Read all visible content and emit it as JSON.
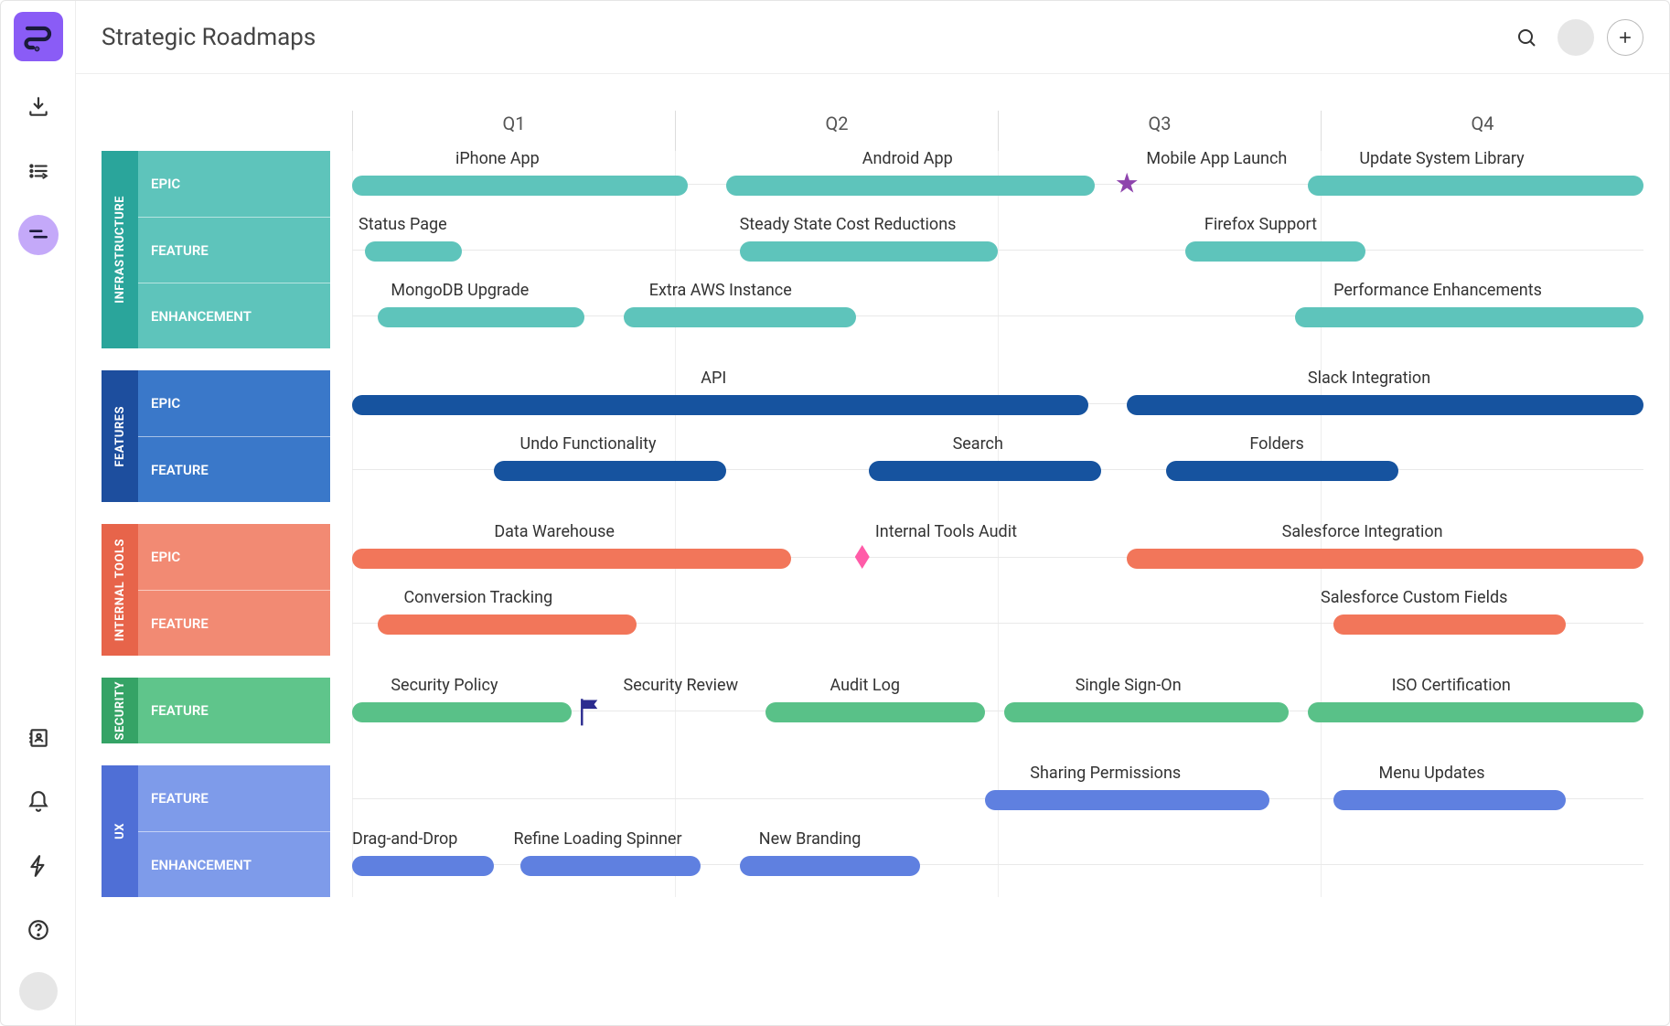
{
  "header": {
    "title": "Strategic Roadmaps"
  },
  "timeline": {
    "quarters": [
      "Q1",
      "Q2",
      "Q3",
      "Q4"
    ]
  },
  "lanes": {
    "infrastructure": {
      "name": "INFRASTRUCTURE",
      "rows": [
        "EPIC",
        "FEATURE",
        "ENHANCEMENT"
      ],
      "items": {
        "epic": {
          "iphone_app": "iPhone App",
          "android_app": "Android App",
          "mobile_launch": "Mobile App Launch",
          "update_syslib": "Update System Library"
        },
        "feature": {
          "status_page": "Status Page",
          "steady_state": "Steady State Cost Reductions",
          "firefox": "Firefox Support"
        },
        "enhancement": {
          "mongodb": "MongoDB Upgrade",
          "aws": "Extra AWS Instance",
          "perf": "Performance Enhancements"
        }
      }
    },
    "features": {
      "name": "FEATURES",
      "rows": [
        "EPIC",
        "FEATURE"
      ],
      "items": {
        "epic": {
          "api": "API",
          "slack": "Slack Integration"
        },
        "feature": {
          "undo": "Undo Functionality",
          "search": "Search",
          "folders": "Folders"
        }
      }
    },
    "internal_tools": {
      "name": "INTERNAL TOOLS",
      "rows": [
        "EPIC",
        "FEATURE"
      ],
      "items": {
        "epic": {
          "dw": "Data Warehouse",
          "audit": "Internal Tools Audit",
          "sf": "Salesforce Integration"
        },
        "feature": {
          "conv": "Conversion Tracking",
          "sfcf": "Salesforce Custom Fields"
        }
      }
    },
    "security": {
      "name": "SECURITY",
      "rows": [
        "FEATURE"
      ],
      "items": {
        "feature": {
          "policy": "Security Policy",
          "review": "Security Review",
          "auditlog": "Audit Log",
          "sso": "Single Sign-On",
          "iso": "ISO Certification"
        }
      }
    },
    "ux": {
      "name": "UX",
      "rows": [
        "FEATURE",
        "ENHANCEMENT"
      ],
      "items": {
        "feature": {
          "sharing": "Sharing Permissions",
          "menu": "Menu Updates"
        },
        "enhancement": {
          "dnd": "Drag-and-Drop",
          "spinner": "Refine Loading Spinner",
          "branding": "New Branding"
        }
      }
    }
  }
}
